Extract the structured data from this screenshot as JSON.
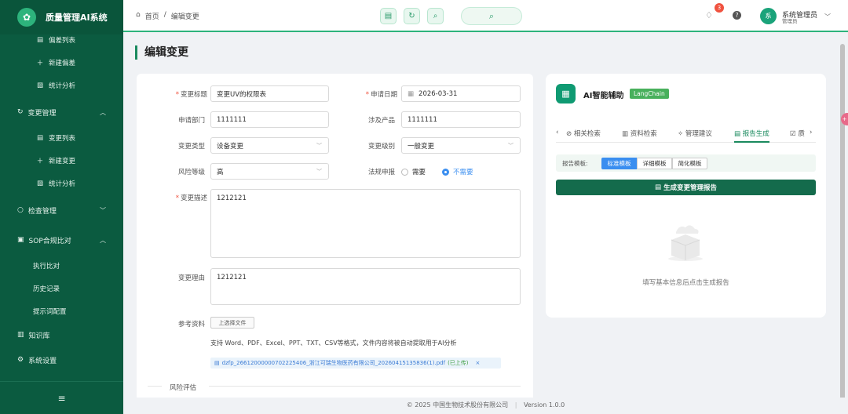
{
  "app": {
    "title": "质量管理AI系统",
    "logo_icon": "ai-logo-icon"
  },
  "sidebar": {
    "items": [
      {
        "label": "偏差列表",
        "icon": "list-icon"
      },
      {
        "label": "新建偏差",
        "icon": "plus-icon"
      },
      {
        "label": "统计分析",
        "icon": "chart-icon"
      },
      {
        "label": "变更管理",
        "icon": "refresh-icon"
      },
      {
        "label": "变更列表",
        "icon": "list-icon"
      },
      {
        "label": "新建变更",
        "icon": "plus-icon"
      },
      {
        "label": "统计分析",
        "icon": "chart-icon"
      },
      {
        "label": "检查管理",
        "icon": "search-icon"
      },
      {
        "label": "SOP合规比对",
        "icon": "file-icon"
      },
      {
        "label": "执行比对"
      },
      {
        "label": "历史记录"
      },
      {
        "label": "提示词配置"
      },
      {
        "label": "知识库",
        "icon": "book-icon"
      },
      {
        "label": "系统设置",
        "icon": "gear-icon"
      }
    ]
  },
  "header": {
    "breadcrumb": {
      "home": "首页",
      "sep": "/",
      "current": "编辑变更"
    },
    "notification_count": "3",
    "user": {
      "name": "系统管理员",
      "role": "管理员",
      "avatar": "系"
    }
  },
  "page": {
    "title": "编辑变更"
  },
  "form": {
    "title_label": "变更标题",
    "title_value": "变更UV的权限表",
    "date_label": "申请日期",
    "date_value": "2026-03-31",
    "dept_label": "申请部门",
    "dept_value": "1111111",
    "product_label": "涉及产品",
    "product_value": "1111111",
    "type_label": "变更类型",
    "type_value": "设备变更",
    "level_label": "变更级别",
    "level_value": "一般变更",
    "risk_label": "风险等级",
    "risk_value": "高",
    "report_label": "法规申报",
    "report_opt1": "需要",
    "report_opt2": "不需要",
    "report_selected": "不需要",
    "desc_label": "变更描述",
    "desc_value": "1212121",
    "reason_label": "变更理由",
    "reason_value": "1212121",
    "ref_label": "参考资料",
    "upload_label": "上选择文件",
    "hint": "支持 Word、PDF、Excel、PPT、TXT、CSV等格式，文件内容将被自动提取用于AI分析",
    "file_name": "dzfp_26612000000702225406_浙江可瑞生物医药有限公司_20260415135836(1).pdf",
    "file_status": "(已上传)",
    "section_risk": "风险评估"
  },
  "ai": {
    "title": "AI智能辅助",
    "badge": "LangChain",
    "tabs": [
      "相关检索",
      "资料检索",
      "管理建议",
      "报告生成",
      "质"
    ],
    "active_tab": "报告生成",
    "template_label": "报告模板:",
    "templates": [
      "标准模板",
      "详细模板",
      "简化模板"
    ],
    "active_template": "标准模板",
    "generate_label": "生成变更管理报告",
    "empty_text": "填写基本信息后点击生成报告"
  },
  "footer": {
    "copyright": "© 2025 中国生物技术股份有限公司",
    "sep": "|",
    "version": "Version 1.0.0"
  }
}
